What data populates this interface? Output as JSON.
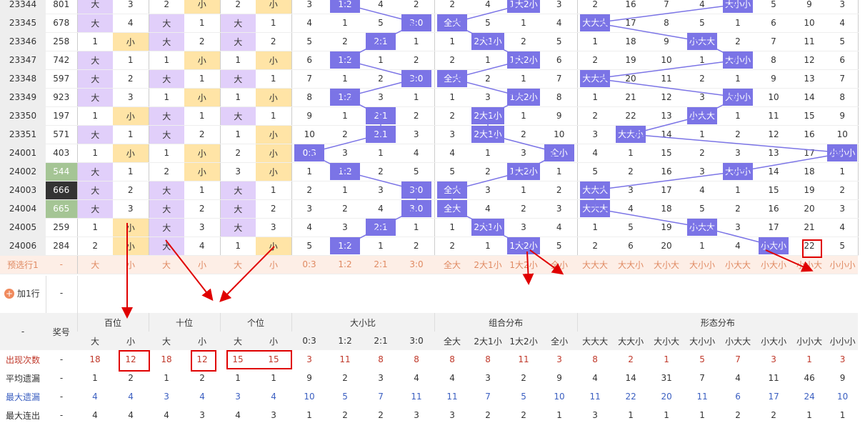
{
  "rows": [
    {
      "id": "23344",
      "num": "801",
      "c": [
        "大",
        "3",
        "2",
        "小",
        "2",
        "小",
        "3",
        "1:2",
        "4",
        "2",
        "2",
        "4",
        "1大2小",
        "3",
        "2",
        "16",
        "7",
        "4",
        "大小小",
        "5",
        "9",
        "3"
      ]
    },
    {
      "id": "23345",
      "num": "678",
      "c": [
        "大",
        "4",
        "大",
        "1",
        "大",
        "1",
        "4",
        "1",
        "5",
        "3:0",
        "全大",
        "5",
        "1",
        "4",
        "大大大",
        "17",
        "8",
        "5",
        "1",
        "6",
        "10",
        "4"
      ]
    },
    {
      "id": "23346",
      "num": "258",
      "c": [
        "1",
        "小",
        "大",
        "2",
        "大",
        "2",
        "5",
        "2",
        "2:1",
        "1",
        "1",
        "2大1小",
        "2",
        "5",
        "1",
        "18",
        "9",
        "小大大",
        "2",
        "7",
        "11",
        "5"
      ]
    },
    {
      "id": "23347",
      "num": "742",
      "c": [
        "大",
        "1",
        "1",
        "小",
        "1",
        "小",
        "6",
        "1:2",
        "1",
        "2",
        "2",
        "1",
        "1大2小",
        "6",
        "2",
        "19",
        "10",
        "1",
        "大小小",
        "8",
        "12",
        "6"
      ]
    },
    {
      "id": "23348",
      "num": "597",
      "c": [
        "大",
        "2",
        "大",
        "1",
        "大",
        "1",
        "7",
        "1",
        "2",
        "3:0",
        "全大",
        "2",
        "1",
        "7",
        "大大大",
        "20",
        "11",
        "2",
        "1",
        "9",
        "13",
        "7"
      ]
    },
    {
      "id": "23349",
      "num": "923",
      "c": [
        "大",
        "3",
        "1",
        "小",
        "1",
        "小",
        "8",
        "1:2",
        "3",
        "1",
        "1",
        "3",
        "1大2小",
        "8",
        "1",
        "21",
        "12",
        "3",
        "大小小",
        "10",
        "14",
        "8"
      ]
    },
    {
      "id": "23350",
      "num": "197",
      "c": [
        "1",
        "小",
        "大",
        "1",
        "大",
        "1",
        "9",
        "1",
        "2:1",
        "2",
        "2",
        "2大1小",
        "1",
        "9",
        "2",
        "22",
        "13",
        "小大大",
        "1",
        "11",
        "15",
        "9"
      ]
    },
    {
      "id": "23351",
      "num": "571",
      "c": [
        "大",
        "1",
        "大",
        "2",
        "1",
        "小",
        "10",
        "2",
        "2:1",
        "3",
        "3",
        "2大1小",
        "2",
        "10",
        "3",
        "大大小",
        "14",
        "1",
        "2",
        "12",
        "16",
        "10"
      ]
    },
    {
      "id": "24001",
      "num": "403",
      "c": [
        "1",
        "小",
        "1",
        "小",
        "2",
        "小",
        "0:3",
        "3",
        "1",
        "4",
        "4",
        "1",
        "3",
        "全小",
        "4",
        "1",
        "15",
        "2",
        "3",
        "13",
        "17",
        "小小小"
      ]
    },
    {
      "id": "24002",
      "num": "544",
      "c": [
        "大",
        "1",
        "2",
        "小",
        "3",
        "小",
        "1",
        "1:2",
        "2",
        "5",
        "5",
        "2",
        "1大2小",
        "1",
        "5",
        "2",
        "16",
        "3",
        "大小小",
        "14",
        "18",
        "1"
      ]
    },
    {
      "id": "24003",
      "num": "666",
      "c": [
        "大",
        "2",
        "大",
        "1",
        "大",
        "1",
        "2",
        "1",
        "3",
        "3:0",
        "全大",
        "3",
        "1",
        "2",
        "大大大",
        "3",
        "17",
        "4",
        "1",
        "15",
        "19",
        "2"
      ]
    },
    {
      "id": "24004",
      "num": "665",
      "c": [
        "大",
        "3",
        "大",
        "2",
        "大",
        "2",
        "3",
        "2",
        "4",
        "3:0",
        "全大",
        "4",
        "2",
        "3",
        "大大大",
        "4",
        "18",
        "5",
        "2",
        "16",
        "20",
        "3"
      ]
    },
    {
      "id": "24005",
      "num": "259",
      "c": [
        "1",
        "小",
        "大",
        "3",
        "大",
        "3",
        "4",
        "3",
        "2:1",
        "1",
        "1",
        "2大1小",
        "3",
        "4",
        "1",
        "5",
        "19",
        "小大大",
        "3",
        "17",
        "21",
        "4"
      ]
    },
    {
      "id": "24006",
      "num": "284",
      "c": [
        "2",
        "小",
        "大",
        "4",
        "1",
        "小",
        "5",
        "1:2",
        "1",
        "2",
        "2",
        "1",
        "1大2小",
        "5",
        "2",
        "6",
        "20",
        "1",
        "4",
        "小大小",
        "22",
        "5"
      ]
    }
  ],
  "preselect": {
    "label": "预选行1",
    "dash": "-",
    "c": [
      "大",
      "小",
      "大",
      "小",
      "大",
      "小",
      "0:3",
      "1:2",
      "2:1",
      "3:0",
      "全大",
      "2大1小",
      "1大2小",
      "全小",
      "大大大",
      "大大小",
      "大小大",
      "大小小",
      "小大大",
      "小大小",
      "小小大",
      "小小小"
    ]
  },
  "addrow": {
    "label": "加1行",
    "dash": "-"
  },
  "header": {
    "dash": "-",
    "prize": "奖号",
    "groups": [
      "百位",
      "十位",
      "个位",
      "大小比",
      "组合分布",
      "形态分布"
    ],
    "sub": [
      "大",
      "小",
      "大",
      "小",
      "大",
      "小",
      "0:3",
      "1:2",
      "2:1",
      "3:0",
      "全大",
      "2大1小",
      "1大2小",
      "全小",
      "大大大",
      "大大小",
      "大小大",
      "大小小",
      "小大大",
      "小大小",
      "小小大",
      "小小小"
    ]
  },
  "stats": [
    {
      "label": "出现次数",
      "dash": "-",
      "v": [
        "18",
        "12",
        "18",
        "12",
        "15",
        "15",
        "3",
        "11",
        "8",
        "8",
        "8",
        "8",
        "11",
        "3",
        "8",
        "2",
        "1",
        "5",
        "7",
        "3",
        "1",
        "3"
      ]
    },
    {
      "label": "平均遗漏",
      "dash": "-",
      "v": [
        "1",
        "2",
        "1",
        "2",
        "1",
        "1",
        "9",
        "2",
        "3",
        "4",
        "4",
        "3",
        "2",
        "9",
        "4",
        "14",
        "31",
        "7",
        "4",
        "11",
        "46",
        "9"
      ]
    },
    {
      "label": "最大遗漏",
      "dash": "-",
      "v": [
        "4",
        "4",
        "3",
        "4",
        "3",
        "4",
        "10",
        "5",
        "7",
        "11",
        "11",
        "7",
        "5",
        "10",
        "11",
        "22",
        "20",
        "11",
        "6",
        "17",
        "24",
        "10"
      ]
    },
    {
      "label": "最大连出",
      "dash": "-",
      "v": [
        "4",
        "4",
        "4",
        "3",
        "4",
        "3",
        "1",
        "2",
        "2",
        "3",
        "3",
        "2",
        "2",
        "1",
        "3",
        "1",
        "1",
        "1",
        "2",
        "2",
        "1",
        "1"
      ]
    }
  ],
  "colors": {
    "purple": "#e1cffa",
    "yellow": "#ffe4a6",
    "badge": "#7b74e6",
    "red": "#e00000"
  }
}
